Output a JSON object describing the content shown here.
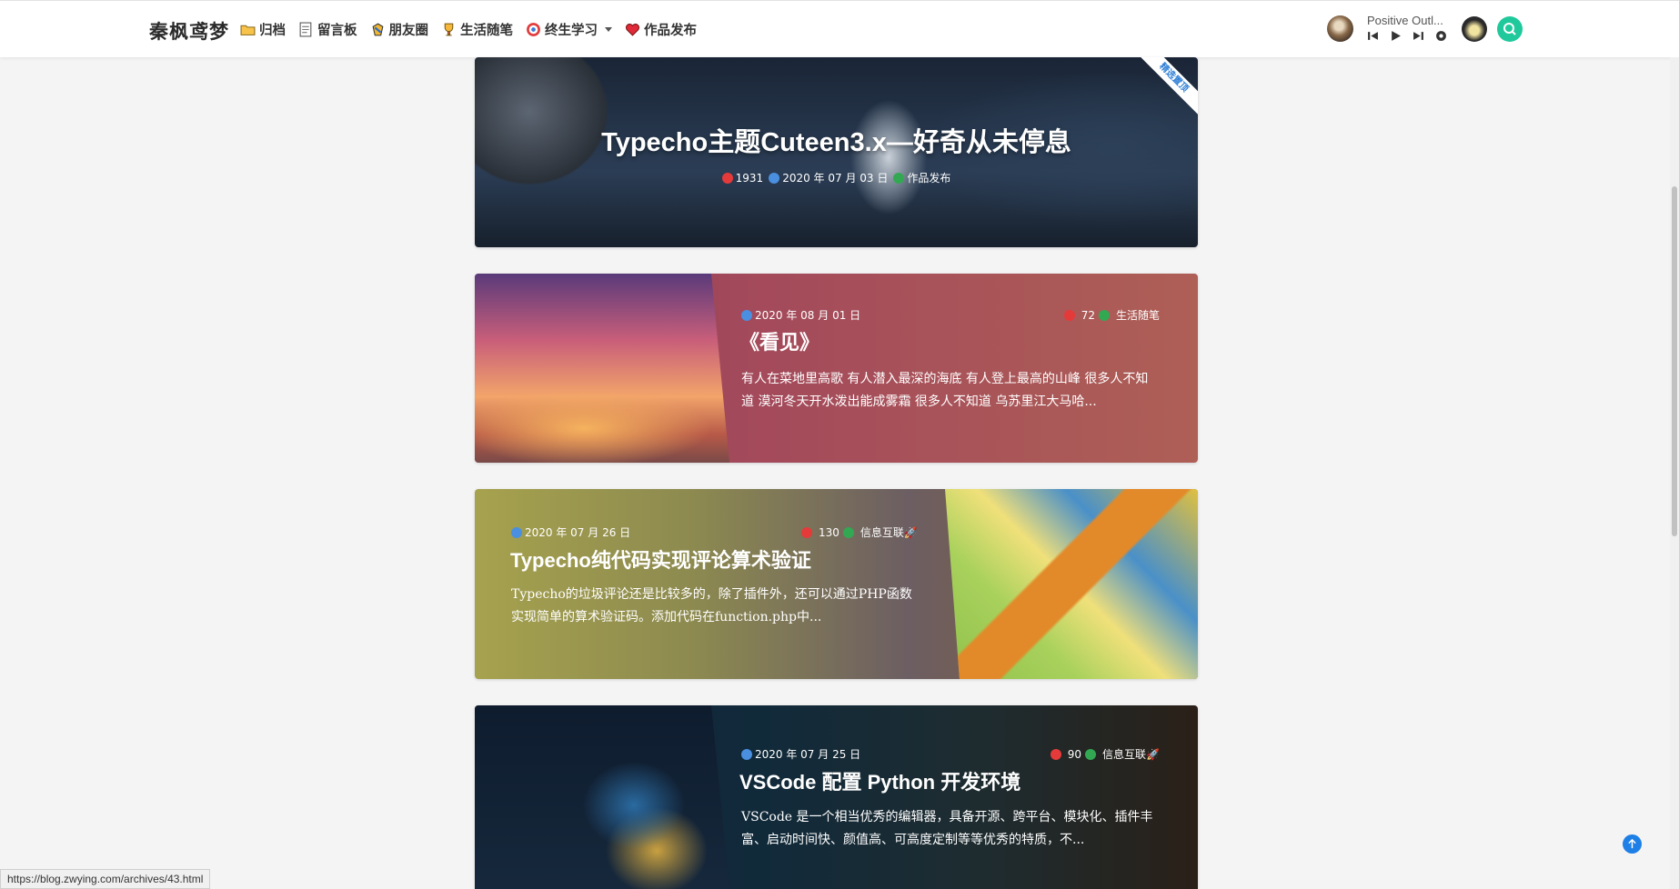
{
  "header": {
    "brand": "秦枫鸢梦",
    "nav": [
      {
        "label": "归档",
        "icon": "folder-icon"
      },
      {
        "label": "留言板",
        "icon": "memo-icon"
      },
      {
        "label": "朋友圈",
        "icon": "friends-icon"
      },
      {
        "label": "生活随笔",
        "icon": "trophy-icon"
      },
      {
        "label": "终生学习",
        "icon": "target-icon",
        "dropdown": true
      },
      {
        "label": "作品发布",
        "icon": "heart-icon"
      }
    ],
    "player": {
      "title": "Positive Outl..."
    }
  },
  "posts": [
    {
      "title": "Typecho主题Cuteen3.x—好奇从未停息",
      "views": "1931",
      "date": "2020 年 07 月 03 日",
      "category": "作品发布",
      "badge": "精选置顶"
    },
    {
      "title": "《看见》",
      "views": "72",
      "date": "2020 年 08 月 01 日",
      "category": "生活随笔",
      "excerpt": "有人在菜地里高歌 有人潜入最深的海底 有人登上最高的山峰 很多人不知道 漠河冬天开水泼出能成雾霜 很多人不知道 乌苏里江大马哈..."
    },
    {
      "title": "Typecho纯代码实现评论算术验证",
      "views": "130",
      "date": "2020 年 07 月 26 日",
      "category": "信息互联🚀",
      "excerpt": "Typecho的垃圾评论还是比较多的，除了插件外，还可以通过PHP函数实现简单的算术验证码。添加代码在function.php中..."
    },
    {
      "title": "VSCode 配置 Python 开发环境",
      "views": "90",
      "date": "2020 年 07 月 25 日",
      "category": "信息互联🚀",
      "excerpt": "VSCode 是一个相当优秀的编辑器，具备开源、跨平台、模块化、插件丰富、启动时间快、颜值高、可高度定制等等优秀的特质，不..."
    }
  ],
  "status_url": "https://blog.zwying.com/archives/43.html",
  "colors": {
    "accent": "#1fc99b",
    "back_top": "#1e7fe6"
  }
}
